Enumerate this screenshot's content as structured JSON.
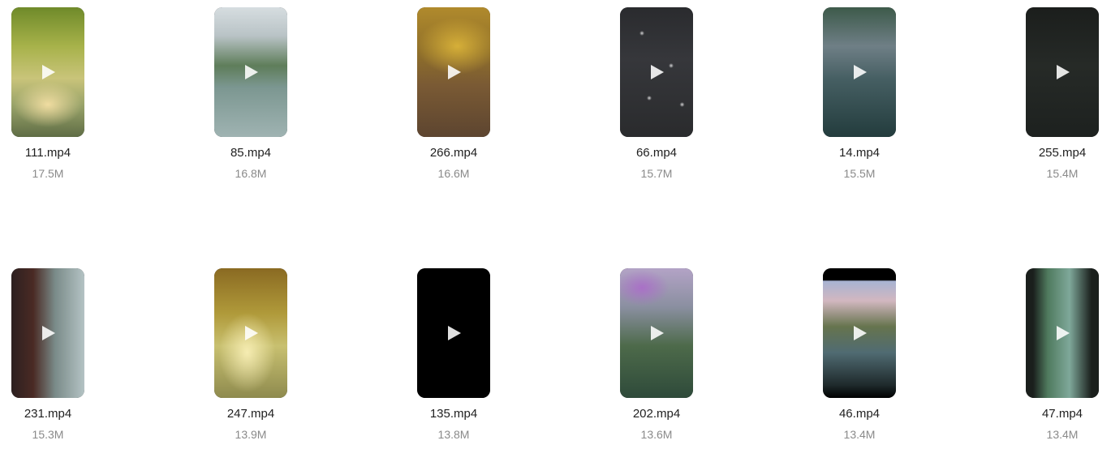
{
  "icons": {
    "play": "play-icon"
  },
  "files": [
    {
      "name": "111.mp4",
      "size": "17.5M"
    },
    {
      "name": "85.mp4",
      "size": "16.8M"
    },
    {
      "name": "266.mp4",
      "size": "16.6M"
    },
    {
      "name": "66.mp4",
      "size": "15.7M"
    },
    {
      "name": "14.mp4",
      "size": "15.5M"
    },
    {
      "name": "255.mp4",
      "size": "15.4M"
    },
    {
      "name": "231.mp4",
      "size": "15.3M"
    },
    {
      "name": "247.mp4",
      "size": "13.9M"
    },
    {
      "name": "135.mp4",
      "size": "13.8M"
    },
    {
      "name": "202.mp4",
      "size": "13.6M"
    },
    {
      "name": "46.mp4",
      "size": "13.4M"
    },
    {
      "name": "47.mp4",
      "size": "13.4M"
    }
  ]
}
